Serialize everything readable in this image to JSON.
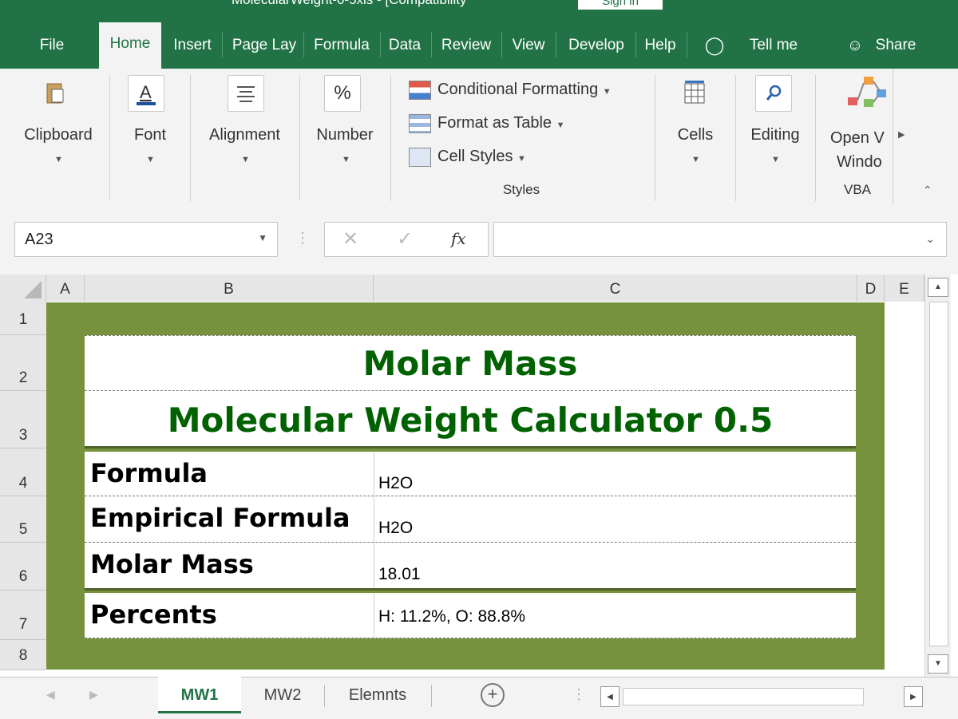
{
  "window": {
    "title": "MolecularWeight-0-5xls - [Compatibility",
    "signin": "Sign in"
  },
  "tabs": [
    "File",
    "Home",
    "Insert",
    "Page Lay",
    "Formula",
    "Data",
    "Review",
    "View",
    "Develop",
    "Help"
  ],
  "tellme": "Tell me",
  "share": "Share",
  "ribbon": {
    "clipboard": "Clipboard",
    "font": "Font",
    "alignment": "Alignment",
    "number": "Number",
    "number_icon": "%",
    "cond_format": "Conditional Formatting",
    "format_table": "Format as Table",
    "cell_styles": "Cell Styles",
    "styles": "Styles",
    "cells": "Cells",
    "editing": "Editing",
    "open_vba_1": "Open V",
    "open_vba_2": "Windo",
    "vba": "VBA"
  },
  "formula_bar": {
    "name_box": "A23",
    "fx": "fx",
    "value": ""
  },
  "columns": [
    "A",
    "B",
    "C",
    "D",
    "E"
  ],
  "rows": [
    "1",
    "2",
    "3",
    "4",
    "5",
    "6",
    "7",
    "8"
  ],
  "sheet": {
    "title1": "Molar Mass",
    "title2": "Molecular Weight Calculator 0.5",
    "formula_label": "Formula",
    "formula_value": "H2O",
    "empirical_label": "Empirical Formula",
    "empirical_value": "H2O",
    "molar_label": "Molar Mass",
    "molar_value": "18.01",
    "percents_label": "Percents",
    "percents_value": "H: 11.2%, O: 88.8%"
  },
  "sheet_tabs": [
    "MW1",
    "MW2",
    "Elemnts"
  ],
  "colors": {
    "excel_green": "#217346",
    "frame_green": "#76923c",
    "title_green": "#006100"
  }
}
